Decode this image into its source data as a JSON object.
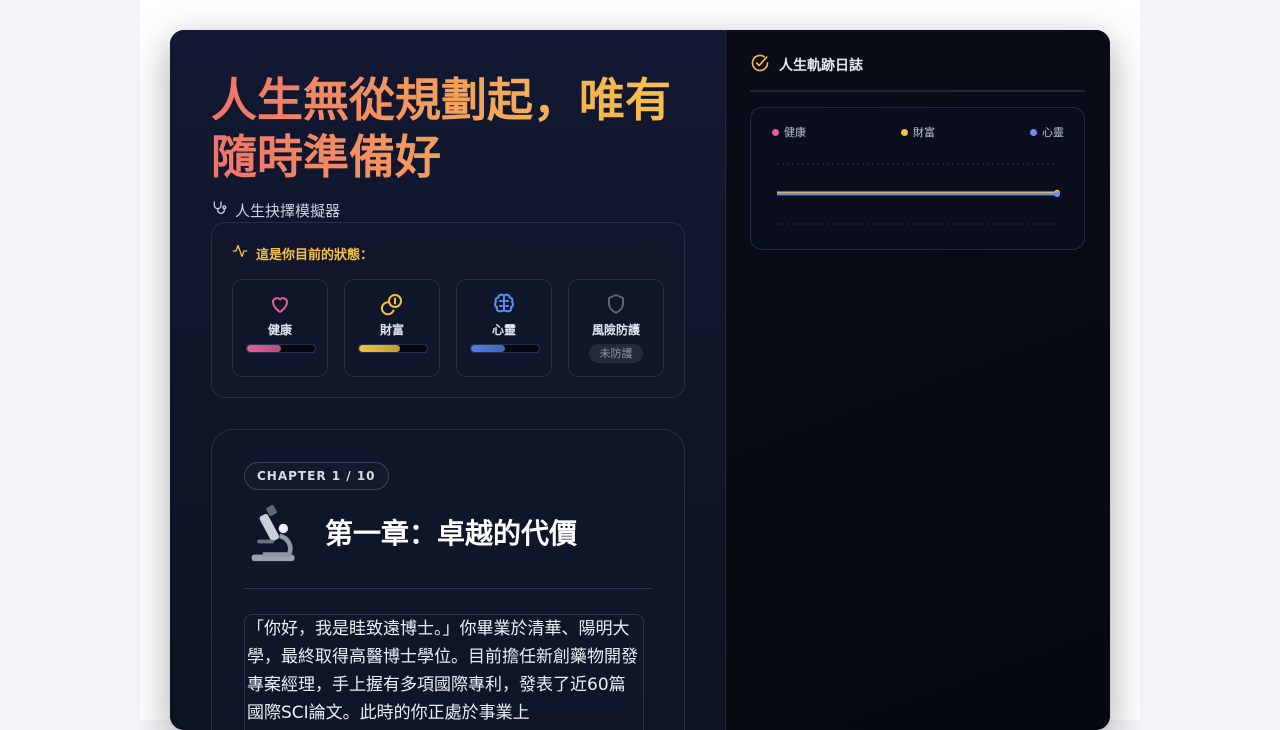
{
  "hero": {
    "line1": "人生無從規劃起，唯有",
    "line2": "隨時準備好"
  },
  "subtitle": "人生抉擇模擬器",
  "status": {
    "title": "這是你目前的狀態：",
    "stats": [
      {
        "label": "健康",
        "icon": "heart-icon",
        "color": "#e0609a",
        "value": 0.5
      },
      {
        "label": "財富",
        "icon": "coins-icon",
        "color": "#f2c23c",
        "value": 0.6
      },
      {
        "label": "心靈",
        "icon": "brain-icon",
        "color": "#4f7fe6",
        "value": 0.5
      },
      {
        "label": "風險防護",
        "icon": "shield-icon",
        "color": "#5b6478",
        "badge": "未防護"
      }
    ]
  },
  "chapter": {
    "badge": "CHAPTER 1 / 10",
    "icon": "microscope-icon",
    "title": "第一章：卓越的代價",
    "story": "「你好，我是眭致遠博士。」你畢業於清華、陽明大學，最終取得高醫博士學位。目前擔任新創藥物開發專案經理，手上握有多項國際專利，發表了近60篇國際SCI論文。此時的你正處於事業上"
  },
  "log": {
    "title": "人生軌跡日誌",
    "icon": "check-circle-icon"
  },
  "chart_data": {
    "type": "line",
    "x": [
      0,
      1
    ],
    "series": [
      {
        "name": "健康",
        "color": "#e0609a",
        "values": [
          50,
          50
        ]
      },
      {
        "name": "財富",
        "color": "#f2c23c",
        "values": [
          52,
          52
        ]
      },
      {
        "name": "心靈",
        "color": "#6b8ff0",
        "values": [
          50,
          50
        ]
      }
    ],
    "ylim": [
      0,
      100
    ],
    "grid": true,
    "legend": "top"
  }
}
